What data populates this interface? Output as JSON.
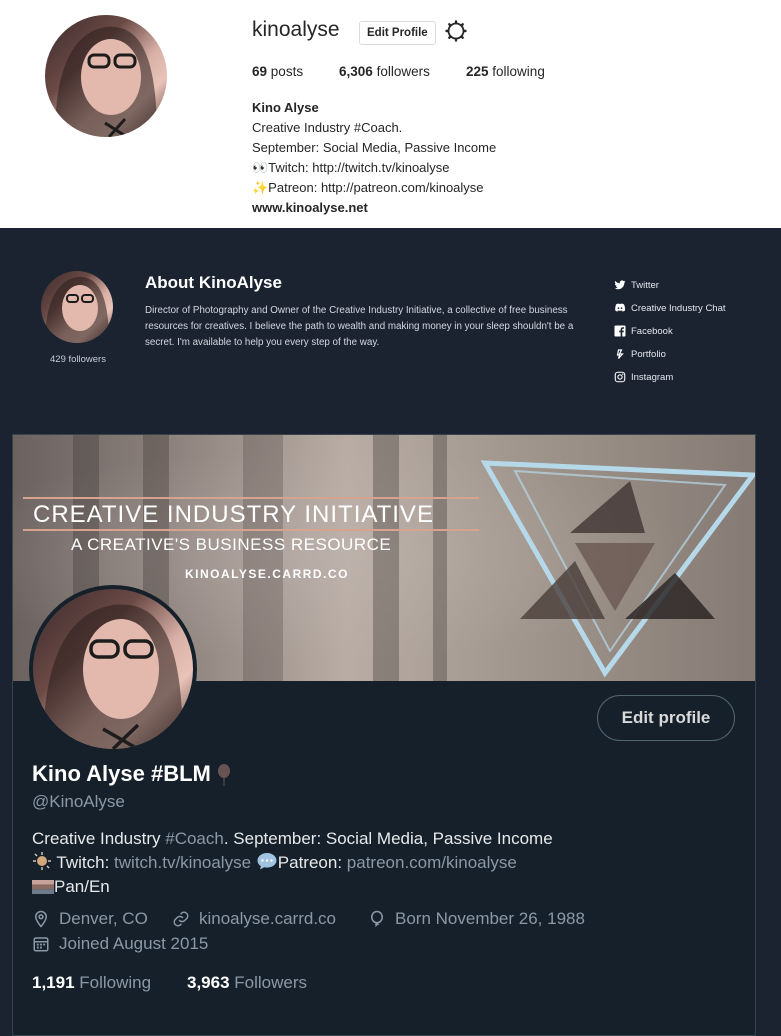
{
  "instagram": {
    "username": "kinoalyse",
    "edit_label": "Edit Profile",
    "posts_count": "69",
    "posts_label": "posts",
    "followers_count": "6,306",
    "followers_label": "followers",
    "following_count": "225",
    "following_label": "following",
    "name": "Kino Alyse",
    "bio": [
      "Creative Industry #Coach.",
      "September: Social Media, Passive Income",
      "👀Twitch: http://twitch.tv/kinoalyse",
      "✨Patreon: http://patreon.com/kinoalyse"
    ],
    "website": "www.kinoalyse.net"
  },
  "about": {
    "title": "About KinoAlyse",
    "followers": "429 followers",
    "description": "Director of Photography and Owner of the Creative Industry Initiative, a collective of free business resources for creatives. I believe the path to wealth and making money in your sleep shouldn't be a secret. I'm available to help you every step of the way.",
    "links": [
      {
        "label": "Twitter",
        "icon": "twitter-icon"
      },
      {
        "label": "Creative Industry Chat",
        "icon": "discord-icon"
      },
      {
        "label": "Facebook",
        "icon": "facebook-icon"
      },
      {
        "label": "Portfolio",
        "icon": "portfolio-icon"
      },
      {
        "label": "Instagram",
        "icon": "instagram-icon"
      }
    ]
  },
  "twitter": {
    "banner_title": "CREATIVE INDUSTRY INITIATIVE",
    "banner_subtitle": "A CREATIVE'S BUSINESS RESOURCE",
    "banner_url": "KINOALYSE.CARRD.CO",
    "edit_label": "Edit profile",
    "display_name": "Kino Alyse #BLM",
    "handle": "@KinoAlyse",
    "bio_line1_a": "Creative Industry ",
    "bio_line1_hash": "#Coach",
    "bio_line1_b": ". September: Social Media, Passive Income",
    "bio_twitch_label": " Twitch: ",
    "bio_twitch_link": "twitch.tv/kinoalyse",
    "bio_patreon_label": "Patreon: ",
    "bio_patreon_link": "patreon.com/kinoalyse",
    "bio_lang": "Pan/En",
    "location": "Denver, CO",
    "website": "kinoalyse.carrd.co",
    "born": "Born November 26, 1988",
    "joined": "Joined August 2015",
    "following_count": "1,191",
    "following_label": "Following",
    "followers_count": "3,963",
    "followers_label": "Followers",
    "accent_color": "#8b98a5"
  }
}
